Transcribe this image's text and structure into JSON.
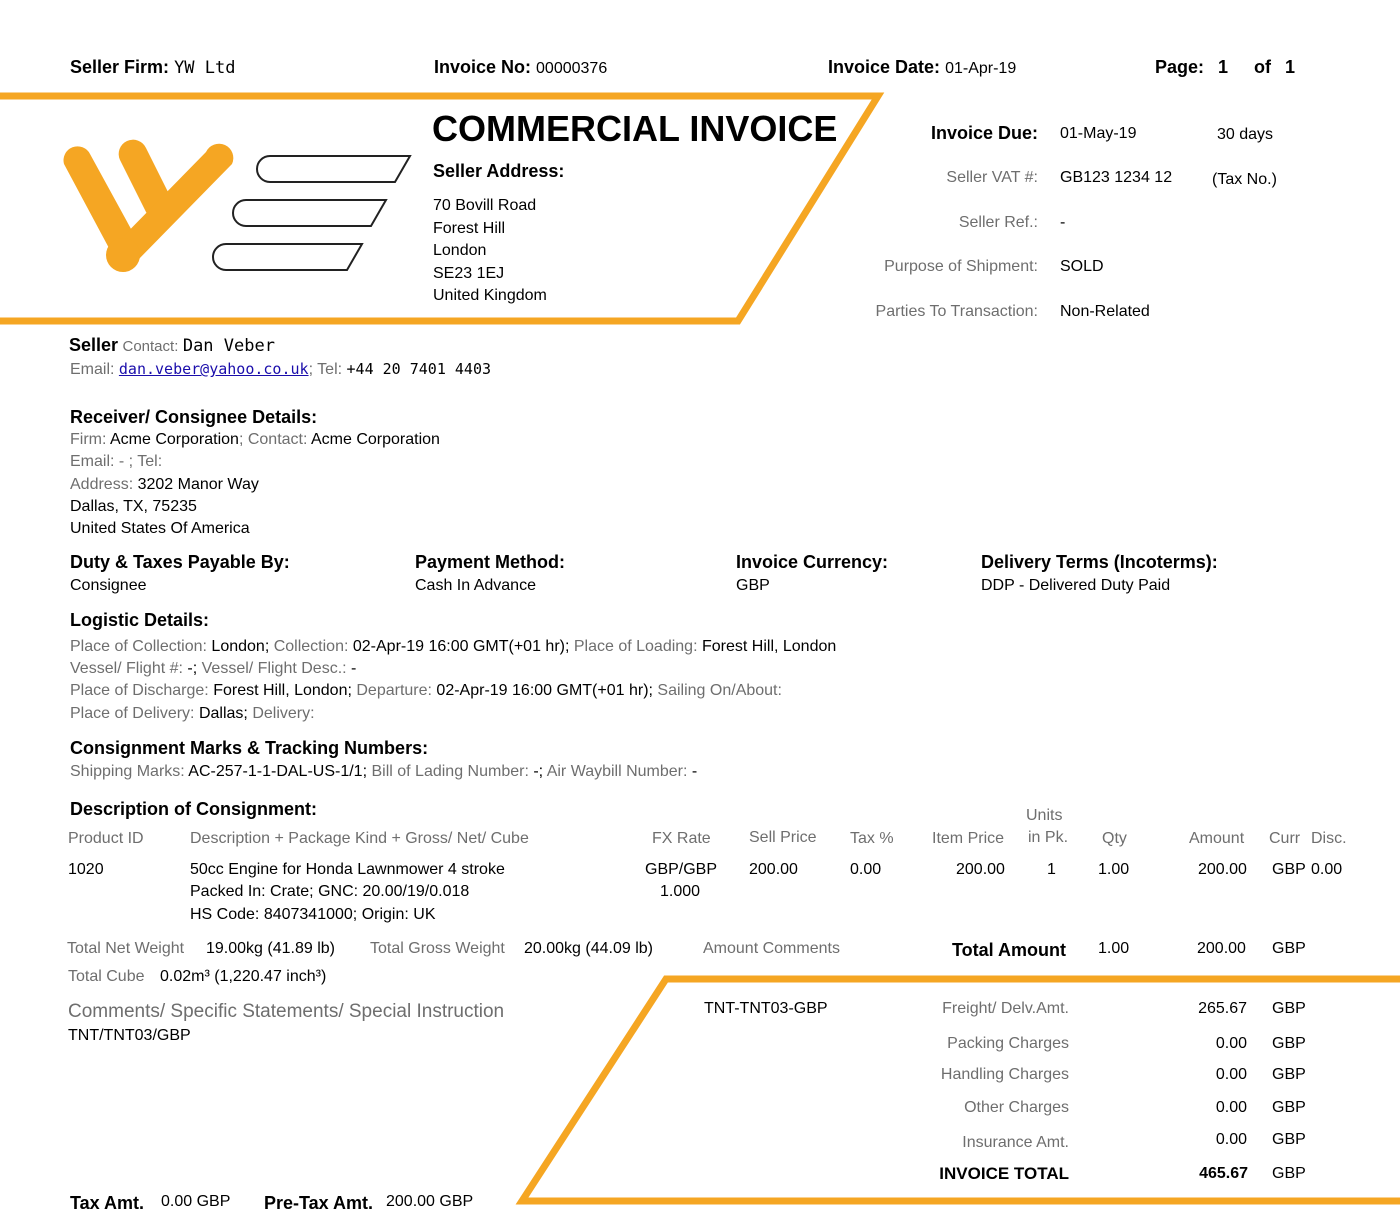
{
  "header": {
    "seller_firm_label": "Seller Firm:",
    "seller_firm": "YW Ltd",
    "invoice_no_label": "Invoice No:",
    "invoice_no": "00000376",
    "invoice_date_label": "Invoice Date:",
    "invoice_date": "01-Apr-19",
    "page_label": "Page:",
    "page": "1",
    "of_label": "of",
    "pages": "1"
  },
  "banner": {
    "title": "COMMERCIAL INVOICE",
    "seller_address_label": "Seller Address:",
    "address_lines": [
      "70 Bovill Road",
      "Forest Hill",
      "London",
      "SE23 1EJ",
      "United Kingdom"
    ]
  },
  "info": {
    "invoice_due_label": "Invoice Due:",
    "invoice_due": "01-May-19",
    "due_days": "30 days",
    "vat_label": "Seller VAT #:",
    "vat": "GB123 1234 12",
    "vat_note": "(Tax No.)",
    "ref_label": "Seller Ref.:",
    "ref": "-",
    "purpose_label": "Purpose of Shipment:",
    "purpose": "SOLD",
    "parties_label": "Parties To Transaction:",
    "parties": "Non-Related"
  },
  "seller": {
    "heading": "Seller",
    "contact_label": "Contact:",
    "contact": "Dan Veber",
    "email_label": "Email:",
    "email": "dan.veber@yahoo.co.uk",
    "tel_label": "; Tel:",
    "tel": "+44 20 7401 4403"
  },
  "receiver": {
    "heading": "Receiver/ Consignee Details:",
    "firm_label": "Firm:",
    "firm": "Acme Corporation",
    "contact_label": "; Contact:",
    "contact": "Acme Corporation",
    "email_line": "Email: - ; Tel:",
    "address_label": "Address:",
    "address": "3202 Manor Way",
    "city": "Dallas, TX, 75235",
    "country": "United States Of America"
  },
  "terms": {
    "duty_label": "Duty & Taxes Payable By:",
    "duty": "Consignee",
    "payment_label": "Payment Method:",
    "payment": "Cash In Advance",
    "currency_label": "Invoice Currency:",
    "currency": "GBP",
    "delivery_label": "Delivery Terms (Incoterms):",
    "delivery": "DDP - Delivered Duty Paid"
  },
  "logistics": {
    "heading": "Logistic Details:",
    "collection_place_label": "Place of Collection:",
    "collection_place": "London;",
    "collection_label": "Collection:",
    "collection": "02-Apr-19 16:00 GMT(+01 hr);",
    "loading_label": "Place of Loading:",
    "loading": "Forest Hill, London",
    "vessel_label": "Vessel/ Flight #:",
    "vessel": "-;",
    "vessel_desc_label": "Vessel/ Flight Desc.:",
    "vessel_desc": "-",
    "discharge_label": "Place of Discharge:",
    "discharge": "Forest Hill, London;",
    "departure_label": "Departure:",
    "departure": "02-Apr-19 16:00 GMT(+01 hr);",
    "sailing_label": "Sailing On/About:",
    "delivery_place_label": "Place of Delivery:",
    "delivery_place": "Dallas;",
    "delivery_label": "Delivery:"
  },
  "marks": {
    "heading": "Consignment Marks & Tracking Numbers:",
    "shipping_label": "Shipping Marks:",
    "shipping": "AC-257-1-1-DAL-US-1/1;",
    "bol_label": "Bill of Lading Number:",
    "bol": "-;",
    "awb_label": "Air Waybill Number:",
    "awb": "-"
  },
  "consignment": {
    "heading": "Description of Consignment:",
    "columns": {
      "product_id": "Product ID",
      "description": "Description + Package Kind + Gross/ Net/ Cube",
      "fx_rate": "FX Rate",
      "sell_price": "Sell Price",
      "tax": "Tax %",
      "item_price": "Item Price",
      "units_1": "Units",
      "units_2": "in Pk.",
      "qty": "Qty",
      "amount": "Amount",
      "curr": "Curr",
      "disc": "Disc."
    },
    "rows": [
      {
        "product_id": "1020",
        "desc_1": "50cc Engine for Honda Lawnmower 4 stroke",
        "desc_2": "Packed In: Crate; GNC: 20.00/19/0.018",
        "desc_3": "HS Code: 8407341000; Origin: UK",
        "fx_1": "GBP/GBP",
        "fx_2": "1.000",
        "sell_price": "200.00",
        "tax": "0.00",
        "item_price": "200.00",
        "units": "1",
        "qty": "1.00",
        "amount": "200.00",
        "curr": "GBP",
        "disc": "0.00"
      }
    ]
  },
  "totals": {
    "net_weight_label": "Total Net Weight",
    "net_weight": "19.00kg (41.89 lb)",
    "gross_weight_label": "Total Gross Weight",
    "gross_weight": "20.00kg (44.09 lb)",
    "amount_comments_label": "Amount Comments",
    "total_amount_label": "Total Amount",
    "total_qty": "1.00",
    "total_amount": "200.00",
    "total_curr": "GBP",
    "cube_label": "Total Cube",
    "cube": "0.02m³ (1,220.47 inch³)"
  },
  "comments": {
    "heading": "Comments/ Specific Statements/ Special Instruction",
    "text": "TNT/TNT03/GBP"
  },
  "charges": {
    "comment": "TNT-TNT03-GBP",
    "items": [
      {
        "label": "Freight/ Delv.Amt.",
        "amount": "265.67",
        "curr": "GBP"
      },
      {
        "label": "Packing Charges",
        "amount": "0.00",
        "curr": "GBP"
      },
      {
        "label": "Handling Charges",
        "amount": "0.00",
        "curr": "GBP"
      },
      {
        "label": "Other Charges",
        "amount": "0.00",
        "curr": "GBP"
      },
      {
        "label": "Insurance Amt.",
        "amount": "0.00",
        "curr": "GBP"
      }
    ],
    "total_label": "INVOICE TOTAL",
    "total": "465.67",
    "total_curr": "GBP"
  },
  "footer": {
    "tax_label": "Tax Amt.",
    "tax": "0.00 GBP",
    "pretax_label": "Pre-Tax Amt.",
    "pretax": "200.00 GBP"
  },
  "colors": {
    "accent": "#F5A623"
  }
}
